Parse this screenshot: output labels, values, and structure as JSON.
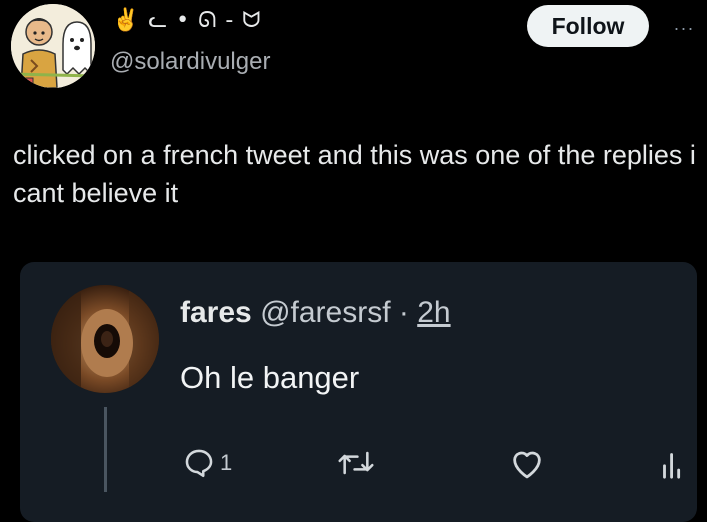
{
  "author": {
    "display_name": "✌️ ᓚ • ᘏ - ᗢ",
    "handle": "@solardivulger"
  },
  "actions": {
    "follow_label": "Follow",
    "more_label": "···"
  },
  "tweet": {
    "text": "clicked on a french tweet and this was one of the replies i cant believe it"
  },
  "reply": {
    "name": "fares",
    "handle": "@faresrsf",
    "separator": " · ",
    "time": "2h",
    "text": "Oh le banger",
    "reply_count": "1"
  },
  "colors": {
    "background": "#000000",
    "card": "#151c24",
    "text": "#e7e9ea",
    "muted": "#a9adb2",
    "follow_bg": "#eff3f4"
  }
}
